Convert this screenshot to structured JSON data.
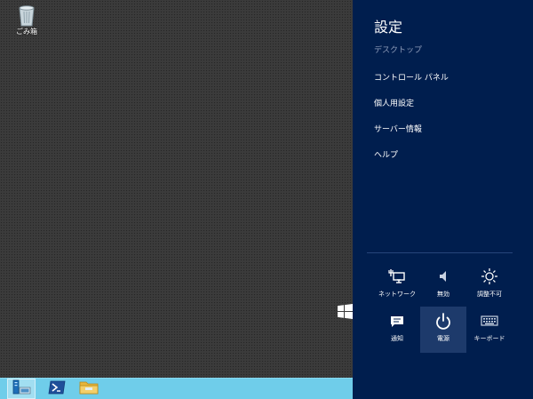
{
  "desktop": {
    "recycle_bin_label": "ごみ箱",
    "icon": "recycle-bin-icon"
  },
  "taskbar": {
    "items": [
      {
        "icon": "server-manager-icon",
        "active": true
      },
      {
        "icon": "powershell-icon",
        "active": false
      },
      {
        "icon": "file-explorer-icon",
        "active": false
      }
    ],
    "color": "#6fcdea"
  },
  "charm": {
    "title": "設定",
    "subtitle": "デスクトップ",
    "links": [
      "コントロール パネル",
      "個人用設定",
      "サーバー情報",
      "ヘルプ"
    ],
    "tiles": [
      {
        "label": "ネットワーク",
        "icon": "network-icon"
      },
      {
        "label": "無効",
        "icon": "speaker-icon"
      },
      {
        "label": "調整不可",
        "icon": "brightness-icon"
      },
      {
        "label": "通知",
        "icon": "notification-icon"
      },
      {
        "label": "電源",
        "icon": "power-icon"
      },
      {
        "label": "キーボード",
        "icon": "keyboard-icon"
      }
    ],
    "background_color": "#001e4e"
  }
}
